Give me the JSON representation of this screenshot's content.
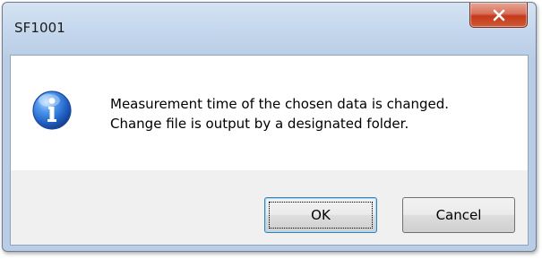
{
  "window": {
    "title": "SF1001"
  },
  "message": {
    "icon": "info-icon",
    "line1": "Measurement time of the chosen data is changed.",
    "line2": "Change file is output by a designated folder."
  },
  "buttons": {
    "ok_label": "OK",
    "cancel_label": "Cancel"
  },
  "colors": {
    "close_button": "#c4391c",
    "info_icon": "#1f5fc4",
    "dialog_body": "#ffffff",
    "button_area": "#f0f0f0"
  }
}
